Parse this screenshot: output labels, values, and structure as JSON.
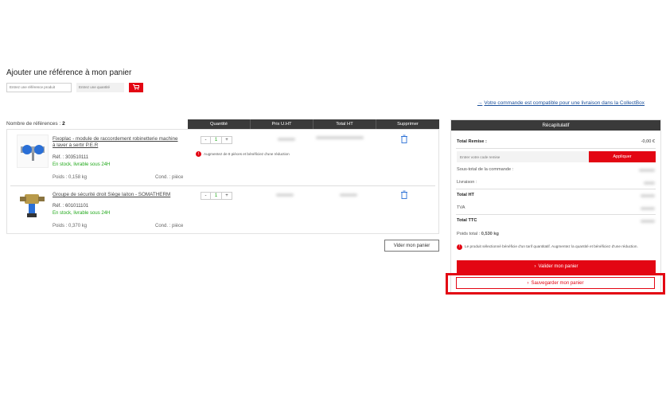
{
  "add_section": {
    "title": "Ajouter une référence à mon panier",
    "ref_placeholder": "Entrez une référence produit",
    "qty_placeholder": "Entrez une quantité",
    "cart_icon": "cart-icon"
  },
  "collect_link": "Votre commande est compatible pour une livraison dans la CollectBox",
  "list": {
    "count_label": "Nombre de références :",
    "count": "2",
    "headers": [
      "Quantité",
      "Prix U.HT",
      "Total HT",
      "Supprimer"
    ]
  },
  "products": [
    {
      "name": "Fixoplac - module de raccordement robinetterie machine à laver à sertir P.E.R",
      "ref": "Réf. : 303510111",
      "stock": "En stock, livrable sous 24H",
      "weight": "Poids : 0,158 kg",
      "cond": "Cond. : pièce",
      "qty": "1",
      "promo_note": "Augmentez de 8 pièces et bénéficiez d'une réduction"
    },
    {
      "name": "Groupe de sécurité droit Siège laiton - SOMATHERM",
      "ref": "Réf. : 601011101",
      "stock": "En stock, livrable sous 24H",
      "weight": "Poids : 0,370 kg",
      "cond": "Cond. : pièce",
      "qty": "1"
    }
  ],
  "stepper": {
    "minus": "-",
    "plus": "+"
  },
  "vider_label": "Vider mon panier",
  "recap": {
    "title": "Récapitulatif",
    "total_remise_label": "Total Remise :",
    "total_remise_value": "-0,00 €",
    "code_placeholder": "Entrer votre code remise",
    "apply_label": "Appliquer",
    "subtotal_label": "Sous-total de la commande :",
    "livraison_label": "Livraison :",
    "total_ht_label": "Total HT",
    "tva_label": "TVA",
    "total_ttc_label": "Total TTC",
    "poids_label": "Poids total :",
    "poids_value": "0,530 kg",
    "note": "Le produit sélectionné bénéficie d'un tarif quantitatif. Augmentez la quantité et bénéficiez d'une réduction.",
    "valider_label": "Valider mon panier",
    "save_label": "Sauvegarder mon panier"
  },
  "colors": {
    "accent": "#e30613",
    "header": "#3a3a3a",
    "stock": "#20a81a",
    "link": "#1a4f9a"
  }
}
